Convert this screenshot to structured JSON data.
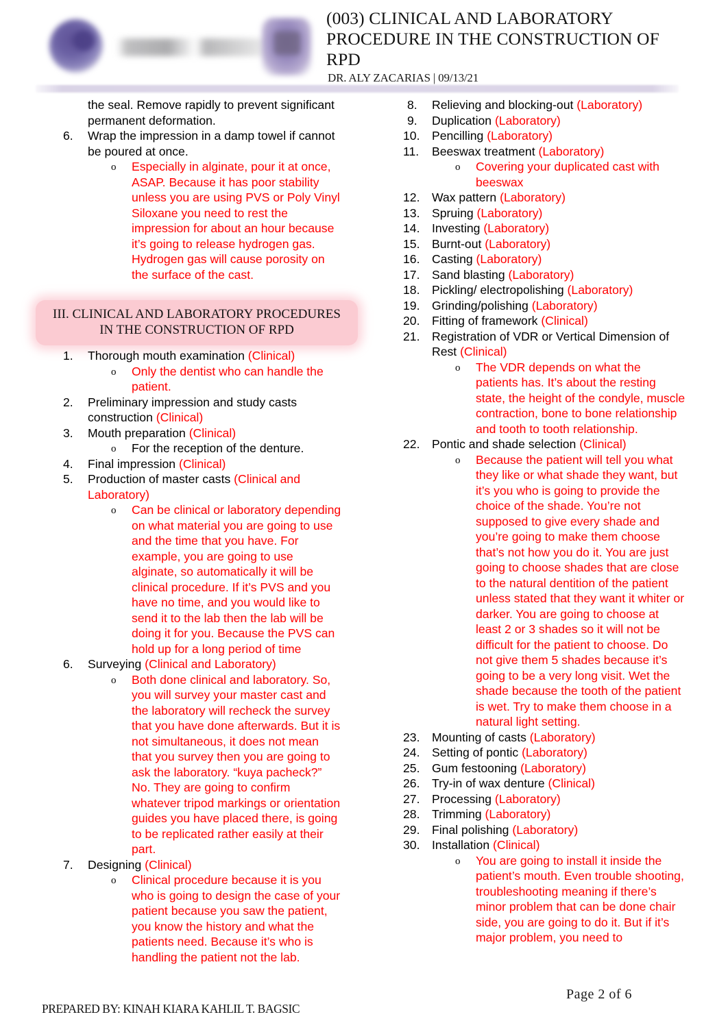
{
  "header": {
    "title": "(003) CLINICAL AND LABORATORY PROCEDURE IN THE CONSTRUCTION OF RPD",
    "subtitle": "DR. ALY ZACARIAS | 09/13/21",
    "logo_left_name": "university-seal-logo",
    "logo_wordmark_name": "blurred-wordmark-logo",
    "logo_right_name": "organization-emblem-logo"
  },
  "colors": {
    "red_accent": "#ff0000",
    "pink_callout": "#fbcbd2",
    "header_rule": "#d8d1e5",
    "text": "#000000"
  },
  "left_column": {
    "continuation": {
      "line1": "the seal. Remove rapidly to prevent significant",
      "line2": "permanent deformation."
    },
    "item6": {
      "number": "6.",
      "text": "Wrap the impression in a damp towel if cannot be poured at once.",
      "sub": "Especially in alginate, pour it at once, ASAP. Because it has poor stability unless you are using PVS or Poly Vinyl Siloxane you need to rest the impression for about an hour because it’s going to release hydrogen gas. Hydrogen gas will cause porosity on the surface of the cast."
    },
    "section_heading": "III. CLINICAL AND LABORATORY PROCEDURES IN THE CONSTRUCTION OF RPD",
    "items": [
      {
        "number": "1.",
        "title": "Thorough mouth examination ",
        "tag": "(Clinical)",
        "sub": "Only the dentist who can handle the patient.",
        "sub_color": "red"
      },
      {
        "number": "2.",
        "title": "Preliminary impression and study casts construction ",
        "tag": "(Clinical)",
        "sub": "",
        "sub_color": "red"
      },
      {
        "number": "3.",
        "title": "Mouth preparation ",
        "tag": "(Clinical)",
        "sub": "For the reception of the denture.",
        "sub_color": "black"
      },
      {
        "number": "4.",
        "title": "Final impression ",
        "tag": "(Clinical)",
        "sub": "",
        "sub_color": "red"
      },
      {
        "number": "5.",
        "title": "Production of master casts ",
        "tag": "(Clinical and Laboratory)",
        "sub": "Can be clinical or laboratory depending on what material you are going to use and the time that you have. For example, you are going to use alginate, so automatically it will be clinical procedure. If it’s PVS and you have no time, and you would like to send it to the lab then the lab will be doing it for you. Because the PVS can hold up for a long period of time",
        "sub_color": "red"
      },
      {
        "number": "6.",
        "title": "Surveying ",
        "tag": "(Clinical and Laboratory)",
        "sub": "Both done clinical and laboratory. So, you will survey your master cast and the laboratory will recheck the survey that you have done afterwards. But it is not simultaneous, it does not mean that you survey then you are going to ask the laboratory. “kuya pacheck?” No. They are going to confirm whatever tripod markings or orientation guides you have placed there, is going to be replicated rather easily at their part.",
        "sub_color": "red"
      },
      {
        "number": "7.",
        "title": "Designing ",
        "tag": "(Clinical)",
        "sub": "Clinical procedure because it is you who is going to design the case of your patient because you saw the patient, you know the history and what the patients need. Because it’s who is handling the patient not the lab.",
        "sub_color": "red"
      }
    ]
  },
  "right_column": {
    "items": [
      {
        "number": "8.",
        "title": "Relieving and blocking-out ",
        "tag": "(Laboratory)",
        "sub": ""
      },
      {
        "number": "9.",
        "title": "Duplication ",
        "tag": "(Laboratory)",
        "sub": ""
      },
      {
        "number": "10.",
        "title": "Pencilling ",
        "tag": "(Laboratory)",
        "sub": ""
      },
      {
        "number": "11.",
        "title": "Beeswax treatment ",
        "tag": "(Laboratory)",
        "sub": "Covering your duplicated cast with beeswax"
      },
      {
        "number": "12.",
        "title": "Wax pattern ",
        "tag": "(Laboratory)",
        "sub": ""
      },
      {
        "number": "13.",
        "title": "Spruing ",
        "tag": "(Laboratory)",
        "sub": ""
      },
      {
        "number": "14.",
        "title": "Investing ",
        "tag": "(Laboratory)",
        "sub": ""
      },
      {
        "number": "15.",
        "title": "Burnt-out ",
        "tag": "(Laboratory)",
        "sub": ""
      },
      {
        "number": "16.",
        "title": "Casting ",
        "tag": "(Laboratory)",
        "sub": ""
      },
      {
        "number": "17.",
        "title": "Sand blasting ",
        "tag": "(Laboratory)",
        "sub": ""
      },
      {
        "number": "18.",
        "title": "Pickling/ electropolishing ",
        "tag": "(Laboratory)",
        "sub": ""
      },
      {
        "number": "19.",
        "title": "Grinding/polishing ",
        "tag": "(Laboratory)",
        "sub": ""
      },
      {
        "number": "20.",
        "title": "Fitting of framework ",
        "tag": "(Clinical)",
        "sub": ""
      },
      {
        "number": "21.",
        "title": "Registration of VDR or Vertical Dimension of Rest ",
        "tag": "(Clinical)",
        "sub": "The VDR depends on what the patients has. It’s about the resting state, the height of the condyle, muscle contraction, bone to bone relationship and tooth to tooth relationship."
      },
      {
        "number": "22.",
        "title": "Pontic and shade selection ",
        "tag": "(Clinical)",
        "sub": "Because the patient will tell you what they like or what shade they want, but it’s you who is going to provide the choice of the shade. You’re not supposed to give every shade and you’re going to make them choose that’s not how you do it. You are just going to choose shades that are close to the natural dentition of the patient unless stated that they want it whiter or darker. You are going to choose at least 2 or 3 shades so it will not be difficult for the patient to choose. Do not give them 5 shades because it’s going to be a very long visit. Wet the shade because the tooth of the patient is wet. Try to make them choose in a natural light setting."
      },
      {
        "number": "23.",
        "title": "Mounting of casts ",
        "tag": "(Laboratory)",
        "sub": ""
      },
      {
        "number": "24.",
        "title": "Setting of pontic ",
        "tag": "(Laboratory)",
        "sub": ""
      },
      {
        "number": "25.",
        "title": "Gum festooning ",
        "tag": "(Laboratory)",
        "sub": ""
      },
      {
        "number": "26.",
        "title": "Try-in of wax denture ",
        "tag": "(Clinical)",
        "sub": ""
      },
      {
        "number": "27.",
        "title": "Processing ",
        "tag": "(Laboratory)",
        "sub": ""
      },
      {
        "number": "28.",
        "title": "Trimming ",
        "tag": "(Laboratory)",
        "sub": ""
      },
      {
        "number": "29.",
        "title": "Final polishing ",
        "tag": "(Laboratory)",
        "sub": ""
      },
      {
        "number": "30.",
        "title": "Installation ",
        "tag": "(Clinical)",
        "sub": "You are going to install it inside the patient’s mouth. Even trouble shooting, troubleshooting meaning if there’s minor problem that can be done chair side, you are going to do it. But if it’s major problem, you need to"
      }
    ]
  },
  "footer": {
    "page_label": "Page   2  of 6",
    "prepared_by": "PREPARED BY: KINAH KIARA KAHLIL T. BAGSIC"
  },
  "bullet_glyph": "o"
}
